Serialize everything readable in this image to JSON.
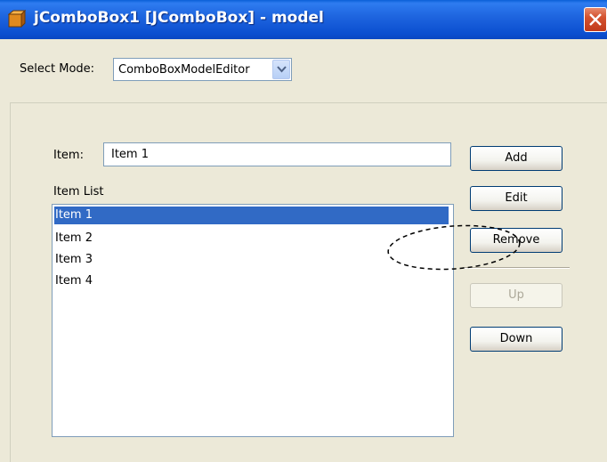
{
  "window": {
    "title": "jComboBox1 [JComboBox] - model"
  },
  "mode": {
    "label": "Select Mode:",
    "value": "ComboBoxModelEditor"
  },
  "item": {
    "label": "Item:",
    "value": "Item 1"
  },
  "list": {
    "label": "Item List",
    "items": [
      "Item 1",
      "Item 2",
      "Item 3",
      "Item 4"
    ],
    "selected_index": 0
  },
  "buttons": {
    "add": "Add",
    "edit": "Edit",
    "remove": "Remove",
    "up": "Up",
    "down": "Down"
  },
  "colors": {
    "titlebar": "#0b4fd0",
    "selection": "#316ac5",
    "close": "#c13a1a"
  }
}
